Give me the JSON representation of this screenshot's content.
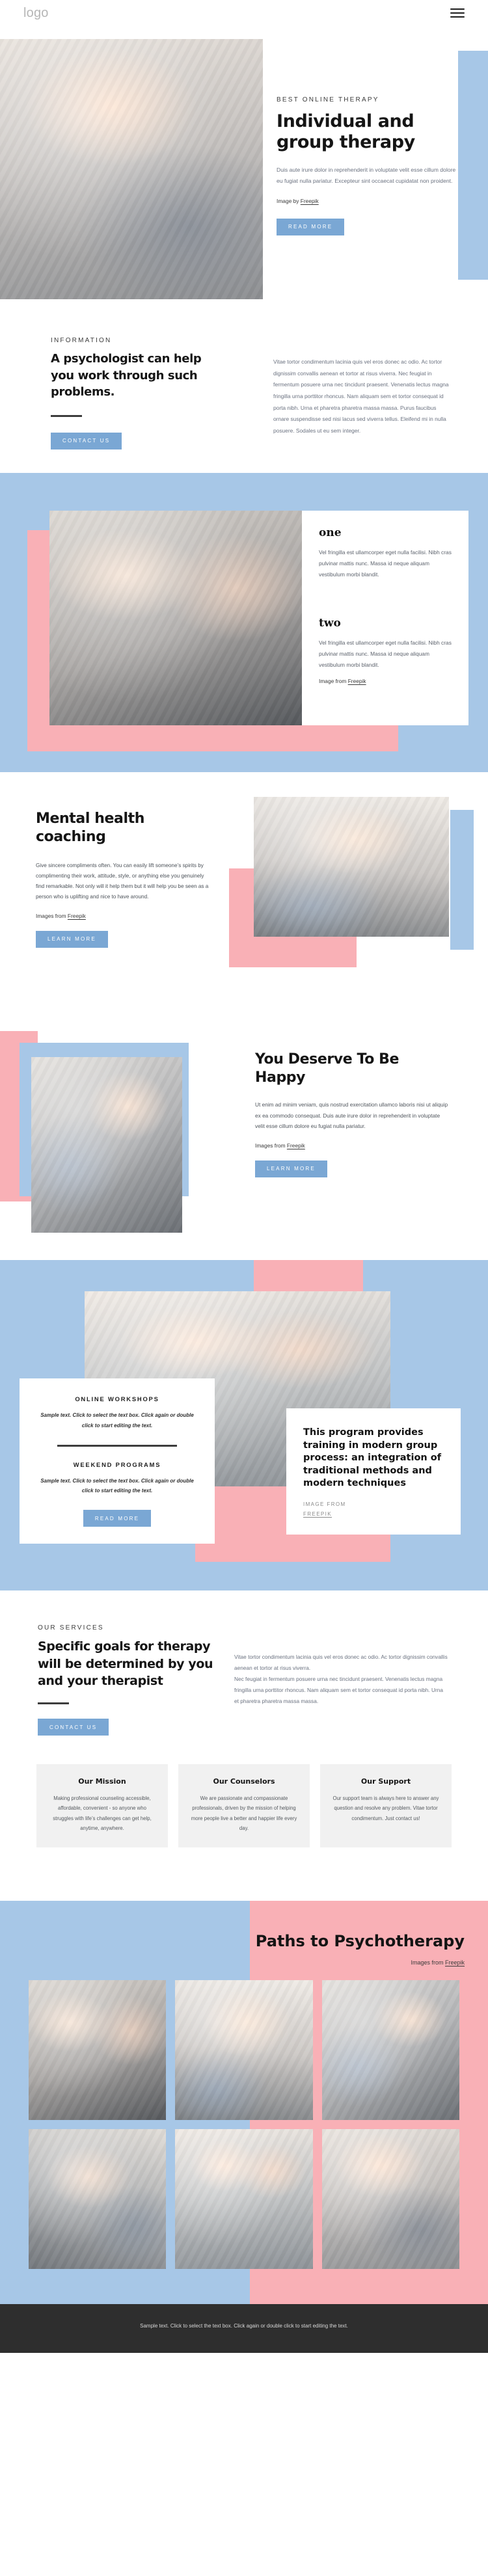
{
  "header": {
    "logo": "logo",
    "menu_icon": "hamburger-menu-icon"
  },
  "hero": {
    "eyebrow": "BEST ONLINE THERAPY",
    "title": "Individual and group therapy",
    "body": "Duis aute irure dolor in reprehenderit in voluptate velit esse cillum dolore eu fugiat nulla pariatur. Excepteur sint occaecat cupidatat non proident.",
    "credit_prefix": "Image by ",
    "credit_link": "Freepik",
    "button": "READ MORE"
  },
  "info": {
    "eyebrow": "INFORMATION",
    "title": "A psychologist can help you work through such problems.",
    "button": "CONTACT US",
    "body": "Vitae tortor condimentum lacinia quis vel eros donec ac odio. Ac tortor dignissim convallis aenean et tortor at risus viverra. Nec feugiat in fermentum posuere urna nec tincidunt praesent. Venenatis lectus magna fringilla urna porttitor rhoncus. Nam aliquam sem et tortor consequat id porta nibh. Urna et pharetra pharetra massa massa. Purus faucibus ornare suspendisse sed nisi lacus sed viverra tellus. Eleifend mi in nulla posuere. Sodales ut eu sem integer."
  },
  "numbered": {
    "one_title": "one",
    "one_body": "Vel fringilla est ullamcorper eget nulla facilisi. Nibh cras pulvinar mattis nunc. Massa id neque aliquam vestibulum morbi blandit.",
    "two_title": "two",
    "two_body": "Vel fringilla est ullamcorper eget nulla facilisi. Nibh cras pulvinar mattis nunc. Massa id neque aliquam vestibulum morbi blandit.",
    "credit_prefix": "Image from ",
    "credit_link": "Freepik"
  },
  "coaching": {
    "title": "Mental health coaching",
    "body": "Give sincere compliments often. You can easily lift someone’s spirits by complimenting their work, attitude, style, or anything else you genuinely find remarkable. Not only will it help them but it will help you be seen as a person who is uplifting and nice to have around.",
    "credit_prefix": "Images from ",
    "credit_link": "Freepik",
    "button": "LEARN MORE"
  },
  "deserve": {
    "title": "You Deserve To Be Happy",
    "body": "Ut enim ad minim veniam, quis nostrud exercitation ullamco laboris nisi ut aliquip ex ea commodo consequat. Duis aute irure dolor in reprehenderit in voluptate velit esse cillum dolore eu fugiat nulla pariatur.",
    "credit_prefix": "Images from ",
    "credit_link": "Freepik",
    "button": "LEARN MORE"
  },
  "program": {
    "workshops_title": "ONLINE WORKSHOPS",
    "workshops_body": "Sample text. Click to select the text box. Click again or double click to start editing the text.",
    "weekend_title": "WEEKEND PROGRAMS",
    "weekend_body": "Sample text. Click to select the text box. Click again or double click to start editing the text.",
    "button": "READ MORE",
    "headline": "This program provides training in modern group process: an integration of traditional methods and modern techniques",
    "meta_prefix": "IMAGE FROM",
    "meta_link": "FREEPIK"
  },
  "services": {
    "eyebrow": "OUR SERVICES",
    "title": "Specific goals for therapy will be determined by you and your therapist",
    "button": "CONTACT US",
    "body": "Vitae tortor condimentum lacinia quis vel eros donec ac odio. Ac tortor dignissim convallis aenean et tortor at risus viverra.\nNec feugiat in fermentum posuere urna nec tincidunt praesent. Venenatis lectus magna fringilla urna porttitor rhoncus. Nam aliquam sem et tortor consequat id porta nibh. Urna et pharetra pharetra massa massa.",
    "cards": [
      {
        "title": "Our Mission",
        "body": "Making professional counseling accessible, affordable, convenient - so anyone who struggles with life’s challenges can get help, anytime, anywhere."
      },
      {
        "title": "Our Counselors",
        "body": "We are passionate and compassionate professionals, driven by the mission of helping more people live a better and happier life every day."
      },
      {
        "title": "Our Support",
        "body": "Our support team is always here to answer any question and resolve any problem. Vitae tortor condimentum. Just contact us!"
      }
    ]
  },
  "paths": {
    "title": "Paths to Psychotherapy",
    "credit_prefix": "Images from ",
    "credit_link": "Freepik"
  },
  "footer": {
    "text": "Sample text. Click to select the text box. Click again or double click to start editing the text."
  },
  "colors": {
    "blue": "#a7c7e7",
    "pink": "#f9b0b6",
    "button": "#7aa7d4",
    "dark": "#2e2e2e",
    "card_bg": "#f1f1f1"
  }
}
